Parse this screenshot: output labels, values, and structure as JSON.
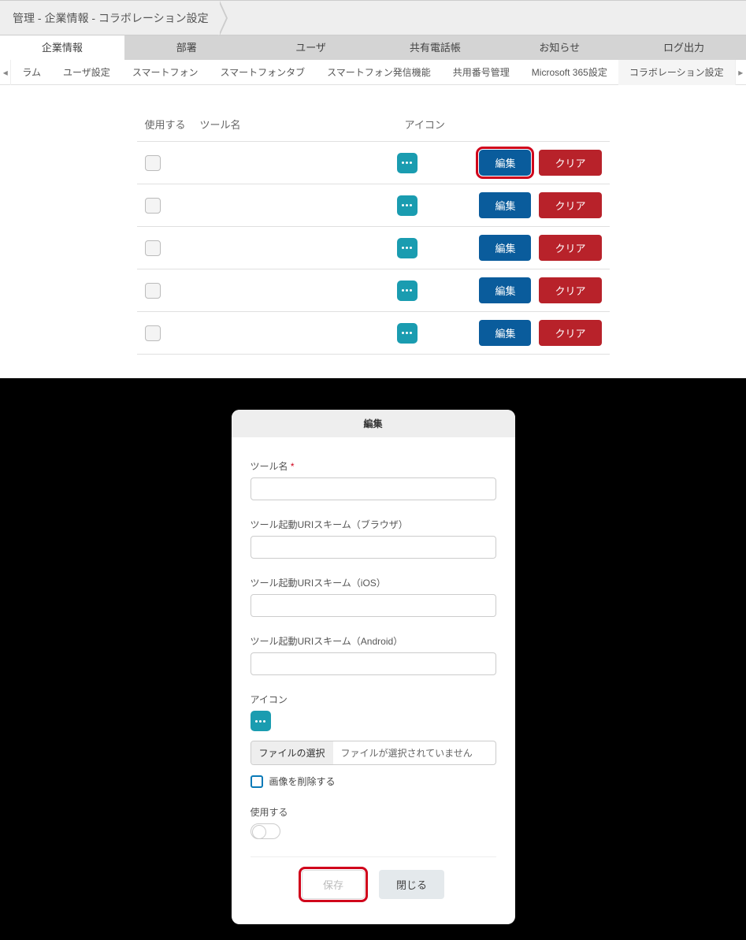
{
  "breadcrumb": "管理 - 企業情報 - コラボレーション設定",
  "main_tabs": [
    "企業情報",
    "部署",
    "ユーザ",
    "共有電話帳",
    "お知らせ",
    "ログ出力"
  ],
  "main_tab_active": 0,
  "sub_tabs": [
    "ラム",
    "ユーザ設定",
    "スマートフォン",
    "スマートフォンタブ",
    "スマートフォン発信機能",
    "共用番号管理",
    "Microsoft 365設定",
    "コラボレーション設定"
  ],
  "sub_tab_active": 7,
  "table": {
    "headers": {
      "use": "使用する",
      "tool": "ツール名",
      "icon": "アイコン"
    },
    "edit_label": "編集",
    "clear_label": "クリア",
    "rows": [
      {
        "use": false
      },
      {
        "use": false
      },
      {
        "use": false
      },
      {
        "use": false
      },
      {
        "use": false
      }
    ]
  },
  "modal": {
    "title": "編集",
    "tool_label": "ツール名",
    "uri_browser_label": "ツール起動URIスキーム（ブラウザ）",
    "uri_ios_label": "ツール起動URIスキーム（iOS）",
    "uri_android_label": "ツール起動URIスキーム（Android）",
    "icon_label": "アイコン",
    "file_select": "ファイルの選択",
    "file_none": "ファイルが選択されていません",
    "delete_image": "画像を削除する",
    "use_label": "使用する",
    "save": "保存",
    "close": "閉じる"
  }
}
